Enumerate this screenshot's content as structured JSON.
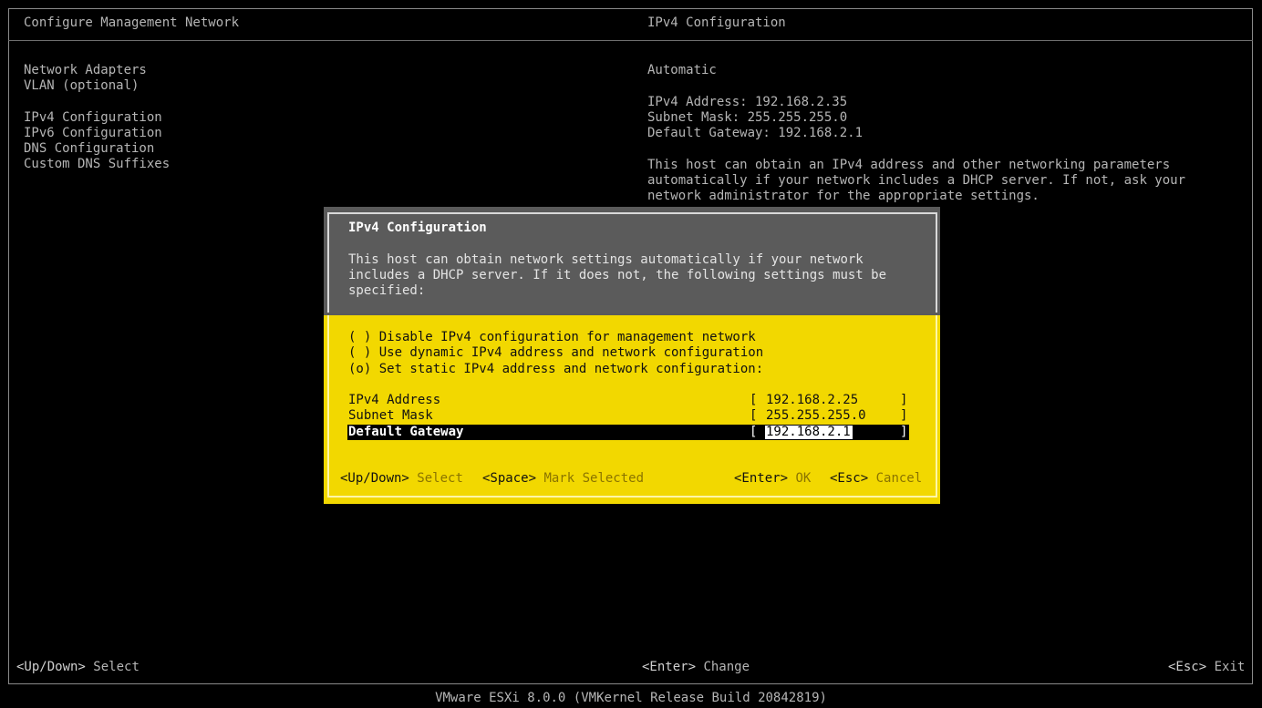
{
  "window": {
    "title_left": "Configure Management Network",
    "title_right": "IPv4 Configuration"
  },
  "menu": {
    "items": [
      {
        "label": "Network Adapters"
      },
      {
        "label": "VLAN (optional)"
      },
      {
        "label": "IPv4 Configuration"
      },
      {
        "label": "IPv6 Configuration"
      },
      {
        "label": "DNS Configuration"
      },
      {
        "label": "Custom DNS Suffixes"
      }
    ]
  },
  "info": {
    "mode": "Automatic",
    "ipv4_address": "IPv4 Address: 192.168.2.35",
    "subnet_mask": "Subnet Mask: 255.255.255.0",
    "default_gateway": "Default Gateway: 192.168.2.1",
    "description_lines": [
      "This host can obtain an IPv4 address and other networking parameters",
      "automatically if your network includes a DHCP server. If not, ask your",
      "network administrator for the appropriate settings."
    ]
  },
  "dialog": {
    "title": "IPv4 Configuration",
    "description_lines": [
      "This host can obtain network settings automatically if your network",
      "includes a DHCP server. If it does not, the following settings must be",
      "specified:"
    ],
    "options": [
      {
        "label": "( ) Disable IPv4 configuration for management network"
      },
      {
        "label": "( ) Use dynamic IPv4 address and network configuration"
      },
      {
        "label": "(o) Set static IPv4 address and network configuration:"
      }
    ],
    "fields": {
      "ipv4_address": {
        "label": "IPv4 Address",
        "value": "192.168.2.25"
      },
      "subnet_mask": {
        "label": "Subnet Mask",
        "value": "255.255.255.0"
      },
      "default_gateway": {
        "label": "Default Gateway",
        "value": "192.168.2.1"
      }
    },
    "bracket_open": "[",
    "bracket_close": "]",
    "footer": {
      "updown_key": "<Up/Down>",
      "updown_action": "Select",
      "space_key": "<Space>",
      "space_action": "Mark Selected",
      "enter_key": "<Enter>",
      "enter_action": "OK",
      "esc_key": "<Esc>",
      "esc_action": "Cancel"
    }
  },
  "bottom_bar": {
    "left_key": "<Up/Down>",
    "left_action": "Select",
    "center_key": "<Enter>",
    "center_action": "Change",
    "right_key": "<Esc>",
    "right_action": "Exit"
  },
  "version": "VMware ESXi 8.0.0 (VMKernel Release Build 20842819)",
  "colors": {
    "dialog_yellow": "#f2d800",
    "dialog_gray": "#5b5b5b",
    "background": "#000000"
  }
}
